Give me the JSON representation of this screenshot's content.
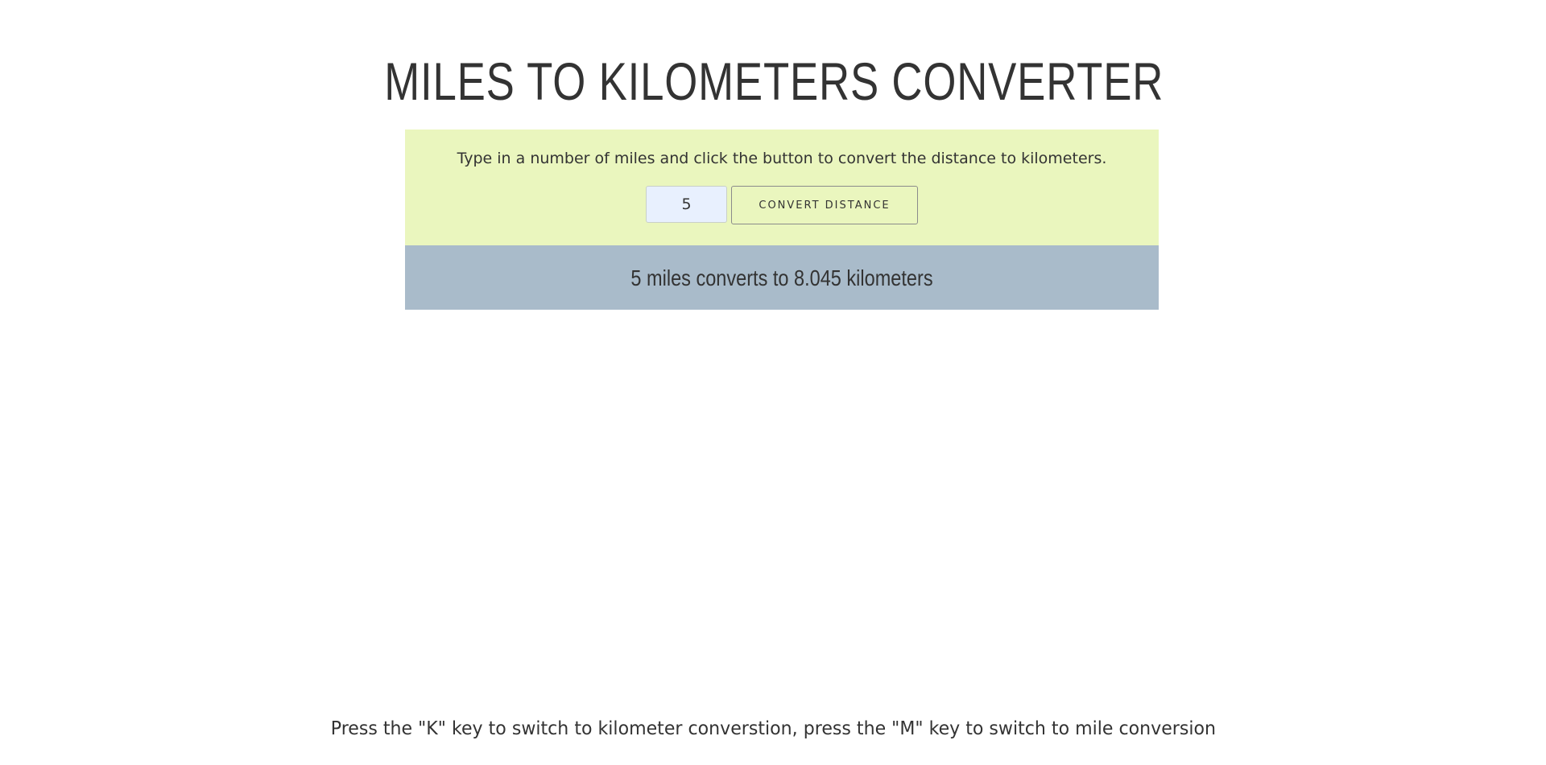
{
  "page": {
    "title": "MILES TO KILOMETERS CONVERTER"
  },
  "converter": {
    "instructions": "Type in a number of miles and click the button to convert the distance to kilometers.",
    "input_value": "5",
    "button_label": "CONVERT DISTANCE",
    "result_text": "5 miles converts to 8.045 kilometers"
  },
  "footer": {
    "hint": "Press the \"K\" key to switch to kilometer converstion, press the \"M\" key to switch to mile conversion"
  },
  "colors": {
    "panel_background": "#eaf6be",
    "result_background": "#a9bbca",
    "input_background": "#e8f0fe",
    "text": "#333333"
  }
}
